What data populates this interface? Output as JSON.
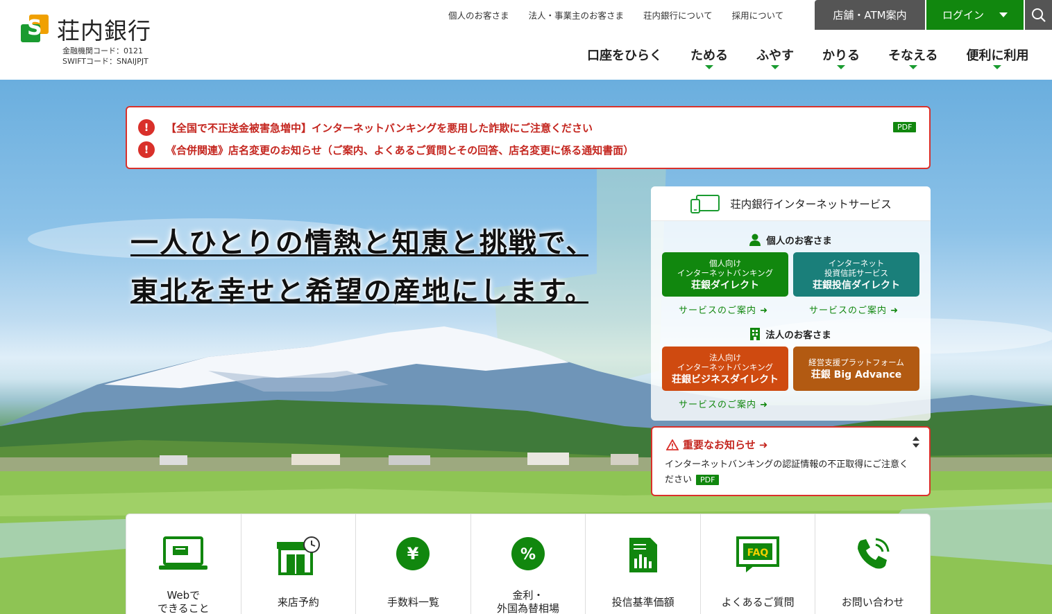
{
  "header": {
    "logo_name": "荘内銀行",
    "bank_code": "金融機関コード：0121",
    "swift_code": "SWIFTコード：SNAIJPJT",
    "top_links": [
      "個人のお客さま",
      "法人・事業主のお客さま",
      "荘内銀行について",
      "採用について"
    ],
    "store_button": "店舗・ATM案内",
    "login_button": "ログイン",
    "main_nav": [
      "口座をひらく",
      "ためる",
      "ふやす",
      "かりる",
      "そなえる",
      "便利に利用"
    ]
  },
  "alerts": [
    {
      "text": "【全国で不正送金被害急増中】インターネットバンキングを悪用した詐欺にご注意ください",
      "icon": "!"
    },
    {
      "text": "《合併関連》店名変更のお知らせ（ご案内、よくあるご質問とその回答、店名変更に係る通知書面）",
      "icon": "!"
    }
  ],
  "alert_pdf": "PDF",
  "slogan": {
    "line1": "一人ひとりの情熱と知恵と挑戦で、",
    "line2": "東北を幸せと希望の産地にします。"
  },
  "internet_service": {
    "title": "荘内銀行インターネットサービス",
    "personal_label": "個人のお客さま",
    "corporate_label": "法人のお客さま",
    "buttons": [
      {
        "sub1": "個人向け",
        "sub2": "インターネットバンキング",
        "name": "荘銀ダイレクト"
      },
      {
        "sub1": "インターネット",
        "sub2": "投資信託サービス",
        "name": "荘銀投信ダイレクト"
      },
      {
        "sub1": "法人向け",
        "sub2": "インターネットバンキング",
        "name": "荘銀ビジネスダイレクト"
      },
      {
        "sub1": "経営支援プラットフォーム",
        "sub2": "",
        "name": "荘銀 Big Advance"
      }
    ],
    "service_link": "サービスのご案内"
  },
  "notice": {
    "title": "重要なお知らせ",
    "body": "インターネットバンキングの認証情報の不正取得にご注意ください",
    "pdf": "PDF"
  },
  "quick_links": [
    {
      "line1": "Webで",
      "line2": "できること",
      "icon": "laptop-icon"
    },
    {
      "line1": "来店予約",
      "line2": "",
      "icon": "store-clock-icon"
    },
    {
      "line1": "手数料一覧",
      "line2": "",
      "icon": "yen-icon"
    },
    {
      "line1": "金利・",
      "line2": "外国為替相場",
      "icon": "percent-icon"
    },
    {
      "line1": "投信基準価額",
      "line2": "",
      "icon": "document-chart-icon"
    },
    {
      "line1": "よくあるご質問",
      "line2": "",
      "icon": "faq-icon"
    },
    {
      "line1": "お問い合わせ",
      "line2": "",
      "icon": "phone-icon"
    }
  ],
  "colors": {
    "brand_green": "#11870e",
    "alert_red": "#d9302a",
    "logo_orange": "#f0a000"
  }
}
